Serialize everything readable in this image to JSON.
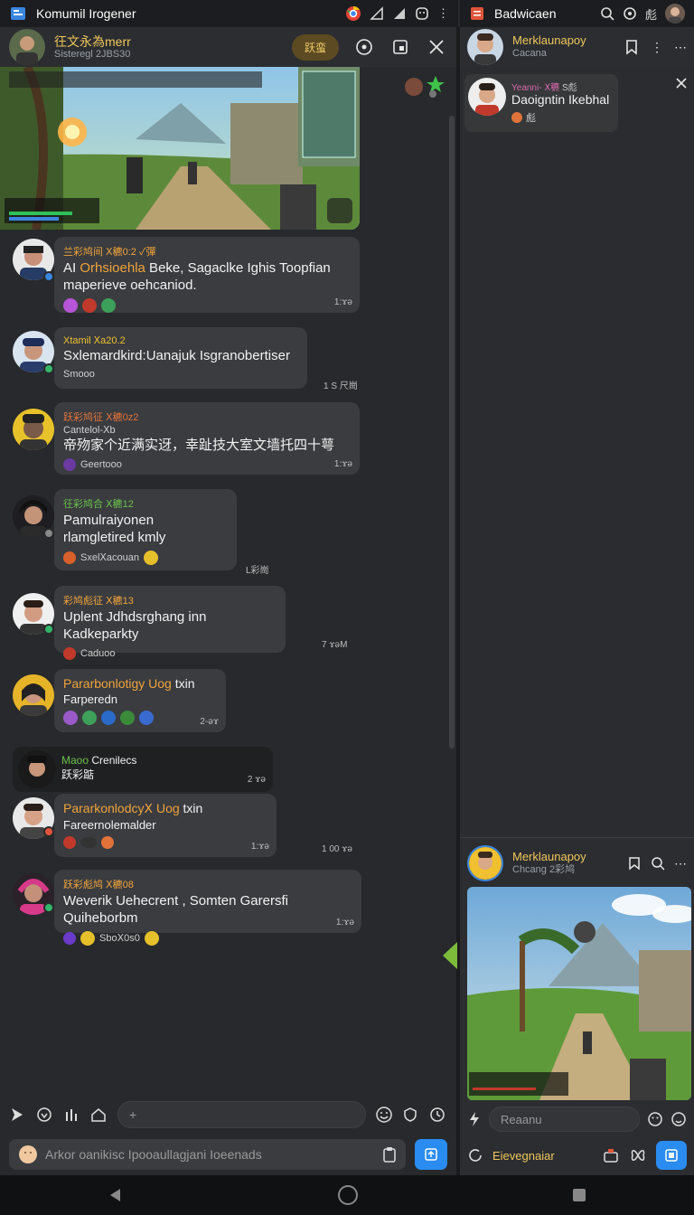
{
  "left_status": {
    "app_title": "Komumil Irogener"
  },
  "right_status": {
    "app_title": "Badwicaen",
    "right_text": "彪"
  },
  "left_header": {
    "title": "彺文永為merr",
    "subtitle": "Sisteregl 2JBS30",
    "pill_label": "跃蛮"
  },
  "messages": [
    {
      "name": "兰彩鸠间 ⵝ穮0:2 ✓彈",
      "name_color": "#f0a33a",
      "text_highlight": "Orhsioehla",
      "text_pre": "AI ",
      "text": " Beke, Sagaclke Ighis Toopfian maperieve oehcaniod.",
      "time": "1:ɤə"
    },
    {
      "name": "Xtamil ⵝa20.2",
      "name_color": "#f0c030",
      "text": "Sxlemardkird:Uanajuk Isgranobertiser",
      "reaction": "Smooo",
      "time": "1 S 尺崗"
    },
    {
      "name": "跃彩鸠征 ⵝ穮0z2",
      "name_color": "#e0733a",
      "sub": "Cantelol-ⵝb",
      "text": "帝歾家个近满实迓，幸趾技大室文墙托四十萼",
      "reaction": "Geertooo",
      "time": "1:ɤə"
    },
    {
      "name": "彺彩鸠合 ⵝ穮12",
      "name_color": "#6cc24a",
      "text": "Pamulraiyonen rlamgletired kmly",
      "reaction": "Sxelⵝacouan",
      "time": "L彩崗"
    },
    {
      "name": "彩鸠彪征 ⵝ穮13",
      "name_color": "#f0a33a",
      "text": "Uplent Jdhdsrghang inn Kadkeparkty",
      "reaction": "Caduoo",
      "time": "7 ɤəM"
    },
    {
      "name": "Pararbonlotigy Uog",
      "name_color": "#f0a33a",
      "name_tail": "txin",
      "text": "Farperedn",
      "time": "2-əɤ"
    },
    {
      "name": "Maoo",
      "name_color": "#6cc24a",
      "name_tail": "Crenilecs",
      "text": "跃彩踮",
      "time": "2 ɤə"
    },
    {
      "name": "Pararkonlodcyⵝ Uog",
      "name_color": "#f0a33a",
      "name_tail": "txin",
      "text": "Fareernolemalder",
      "time": "1:ɤə"
    },
    {
      "name": "跃彩彪鸠 ⵝ穮08",
      "name_color": "#f0a33a",
      "text": "Weverik Uehecrent , Somten Garersfi Quiheborbm",
      "reaction": "Sboⵝ0s0",
      "time": "1:ɤə"
    }
  ],
  "side_times": {
    "t1": "1 S 尺崗",
    "t2": "L彩崗",
    "t3": "7 ɤəM",
    "t4": "1 00 ɤə"
  },
  "toolbar": {
    "input_placeholder": "+"
  },
  "composer": {
    "placeholder": "Arkor oanikisc Ipooaullagjani Ioeenads"
  },
  "right_header": {
    "name": "Merklaunapoy",
    "sub": "Cacana"
  },
  "popup": {
    "line1": "Yeanni- ⵝ穮",
    "line1_tail": "S彪",
    "line2": "Daoigntin Ikebhal",
    "line3": "彪"
  },
  "right_bottom": {
    "name": "Merklaunapoy",
    "sub": "Chcang 2彩鸠",
    "input_placeholder": "Reaanu"
  },
  "right_footer": {
    "label": "Eievegnaiar"
  },
  "colors": {
    "accent_blue": "#2a8cf0",
    "gold": "#f0c75a",
    "green_badge": "#35b56a"
  }
}
